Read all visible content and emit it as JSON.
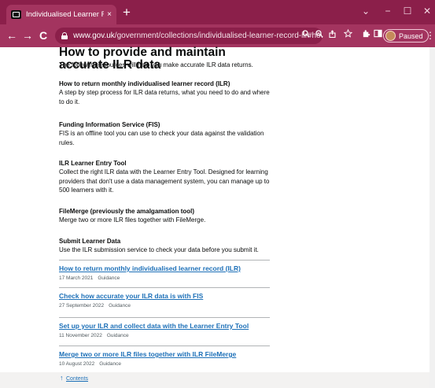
{
  "browser": {
    "tab_title": "Individualised Learner Record (ILR",
    "tab_close": "×",
    "new_tab": "+",
    "url_host": "www.gov.uk",
    "url_path": "/government/collections/individualised-learner-record-ilr#how-to-pr...",
    "profile_status": "Paused",
    "window_controls": [
      "⌄",
      "−",
      "☐",
      "✕"
    ],
    "nav": {
      "back": "←",
      "forward": "→",
      "reload": "C"
    },
    "toolbar_icons": [
      "search-icon",
      "zoom-icon",
      "share-icon",
      "bookmark-star-icon",
      "extensions-icon",
      "sidebar-icon"
    ]
  },
  "page": {
    "title": "How to provide and maintain accurate ILR data",
    "intro": "The following resources will help you make accurate ILR data returns.",
    "sections": [
      {
        "heading": "How to return monthly individualised learner record (ILR)",
        "text": "A step by step process for ILR data returns, what you need to do and where to do it."
      },
      {
        "heading": "Funding Information Service (FIS)",
        "text": "FIS is an offline tool you can use to check your data against the validation rules."
      },
      {
        "heading": "ILR Learner Entry Tool",
        "text": "Collect the right ILR data with the Learner Entry Tool. Designed for learning providers that don't use a data management system, you can manage up to 500 learners with it."
      },
      {
        "heading": "FileMerge (previously the amalgamation tool)",
        "text": "Merge two or more ILR files together with FileMerge."
      },
      {
        "heading": "Submit Learner Data",
        "text": "Use the ILR submission service to check your data before you submit it."
      }
    ],
    "documents": [
      {
        "title": "How to return monthly individualised learner record (ILR)",
        "date": "17 March 2021",
        "type": "Guidance"
      },
      {
        "title": "Check how accurate your ILR data is with FIS",
        "date": "27 September 2022",
        "type": "Guidance"
      },
      {
        "title": "Set up your ILR and collect data with the Learner Entry Tool",
        "date": "11 November 2022",
        "type": "Guidance"
      },
      {
        "title": "Merge two or more ILR files together with ILR FileMerge",
        "date": "10 August 2022",
        "type": "Guidance"
      }
    ],
    "contents_link": "Contents"
  },
  "colors": {
    "tab_bar": "#8b1f4a",
    "toolbar": "#a3345f",
    "link": "#1d70b8"
  }
}
